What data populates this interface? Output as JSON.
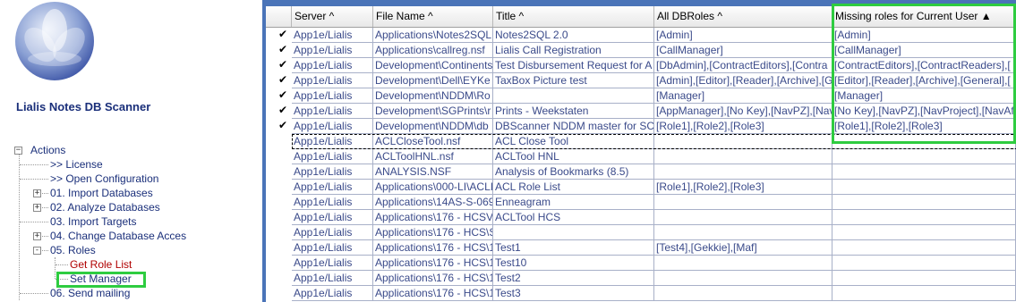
{
  "app_title": "Lialis Notes DB Scanner",
  "tree": {
    "root_label": "Actions",
    "items": [
      {
        "label": ">> License",
        "expander": ""
      },
      {
        "label": ">> Open Configuration",
        "expander": ""
      },
      {
        "label": "01. Import Databases",
        "expander": "+"
      },
      {
        "label": "02. Analyze Databases",
        "expander": "+"
      },
      {
        "label": "03. Import Targets",
        "expander": ""
      },
      {
        "label": "04. Change Database Acces",
        "expander": "+"
      },
      {
        "label": "05. Roles",
        "expander": "-"
      },
      {
        "label": "Get Role List",
        "expander": ""
      },
      {
        "label": "Set Manager",
        "expander": ""
      },
      {
        "label": "06. Send mailing",
        "expander": ""
      }
    ]
  },
  "grid": {
    "columns": [
      "Server ^",
      "File Name ^",
      "Title ^",
      "All DBRoles ^",
      "Missing roles for Current User ▲"
    ],
    "rows": [
      {
        "checked": true,
        "cells": [
          "App1e/Lialis",
          "Applications\\Notes2SQL",
          "Notes2SQL 2.0",
          "[Admin]",
          "[Admin]"
        ]
      },
      {
        "checked": true,
        "cells": [
          "App1e/Lialis",
          "Applications\\callreg.nsf",
          "Lialis Call Registration",
          "[CallManager]",
          "[CallManager]"
        ]
      },
      {
        "checked": true,
        "cells": [
          "App1e/Lialis",
          "Development\\Continents",
          "Test Disbursement Request for A",
          "[DbAdmin],[ContractEditors],[Contra",
          "[ContractEditors],[ContractReaders],["
        ]
      },
      {
        "checked": true,
        "cells": [
          "App1e/Lialis",
          "Development\\Dell\\EYKe",
          "TaxBox Picture test",
          "[Admin],[Editor],[Reader],[Archive],[G",
          "[Editor],[Reader],[Archive],[General],["
        ]
      },
      {
        "checked": true,
        "cells": [
          "App1e/Lialis",
          "Development\\NDDM\\Ro",
          "",
          "[Manager]",
          "[Manager]"
        ]
      },
      {
        "checked": true,
        "cells": [
          "App1e/Lialis",
          "Development\\SGPrints\\r",
          "Prints - Weekstaten",
          "[AppManager],[No Key],[NavPZ],[Nav",
          "[No Key],[NavPZ],[NavProject],[NavAf"
        ]
      },
      {
        "checked": true,
        "cells": [
          "App1e/Lialis",
          "Development\\NDDM\\db",
          "DBScanner NDDM master for SC",
          "[Role1],[Role2],[Role3]",
          "[Role1],[Role2],[Role3]"
        ]
      },
      {
        "checked": false,
        "cells": [
          "App1e/Lialis",
          "ACLCloseTool.nsf",
          "ACL Close Tool",
          "",
          ""
        ]
      },
      {
        "checked": false,
        "cells": [
          "App1e/Lialis",
          "ACLToolHNL.nsf",
          "ACLTool HNL",
          "",
          ""
        ]
      },
      {
        "checked": false,
        "cells": [
          "App1e/Lialis",
          "ANALYSIS.NSF",
          "Analysis of Bookmarks (8.5)",
          "",
          ""
        ]
      },
      {
        "checked": false,
        "cells": [
          "App1e/Lialis",
          "Applications\\000-LI\\ACLI",
          "ACL Role List",
          "[Role1],[Role2],[Role3]",
          ""
        ]
      },
      {
        "checked": false,
        "cells": [
          "App1e/Lialis",
          "Applications\\14AS-S-069",
          "Enneagram",
          "",
          ""
        ]
      },
      {
        "checked": false,
        "cells": [
          "App1e/Lialis",
          "Applications\\176 - HCSV",
          "ACLTool HCS",
          "",
          ""
        ]
      },
      {
        "checked": false,
        "cells": [
          "App1e/Lialis",
          "Applications\\176 - HCS\\S",
          "",
          "",
          ""
        ]
      },
      {
        "checked": false,
        "cells": [
          "App1e/Lialis",
          "Applications\\176 - HCS\\1",
          "Test1",
          "[Test4],[Gekkie],[Maf]",
          ""
        ]
      },
      {
        "checked": false,
        "cells": [
          "App1e/Lialis",
          "Applications\\176 - HCS\\1",
          "Test10",
          "",
          ""
        ]
      },
      {
        "checked": false,
        "cells": [
          "App1e/Lialis",
          "Applications\\176 - HCS\\1",
          "Test2",
          "",
          ""
        ]
      },
      {
        "checked": false,
        "cells": [
          "App1e/Lialis",
          "Applications\\176 - HCS\\1",
          "Test3",
          "",
          ""
        ]
      }
    ]
  }
}
